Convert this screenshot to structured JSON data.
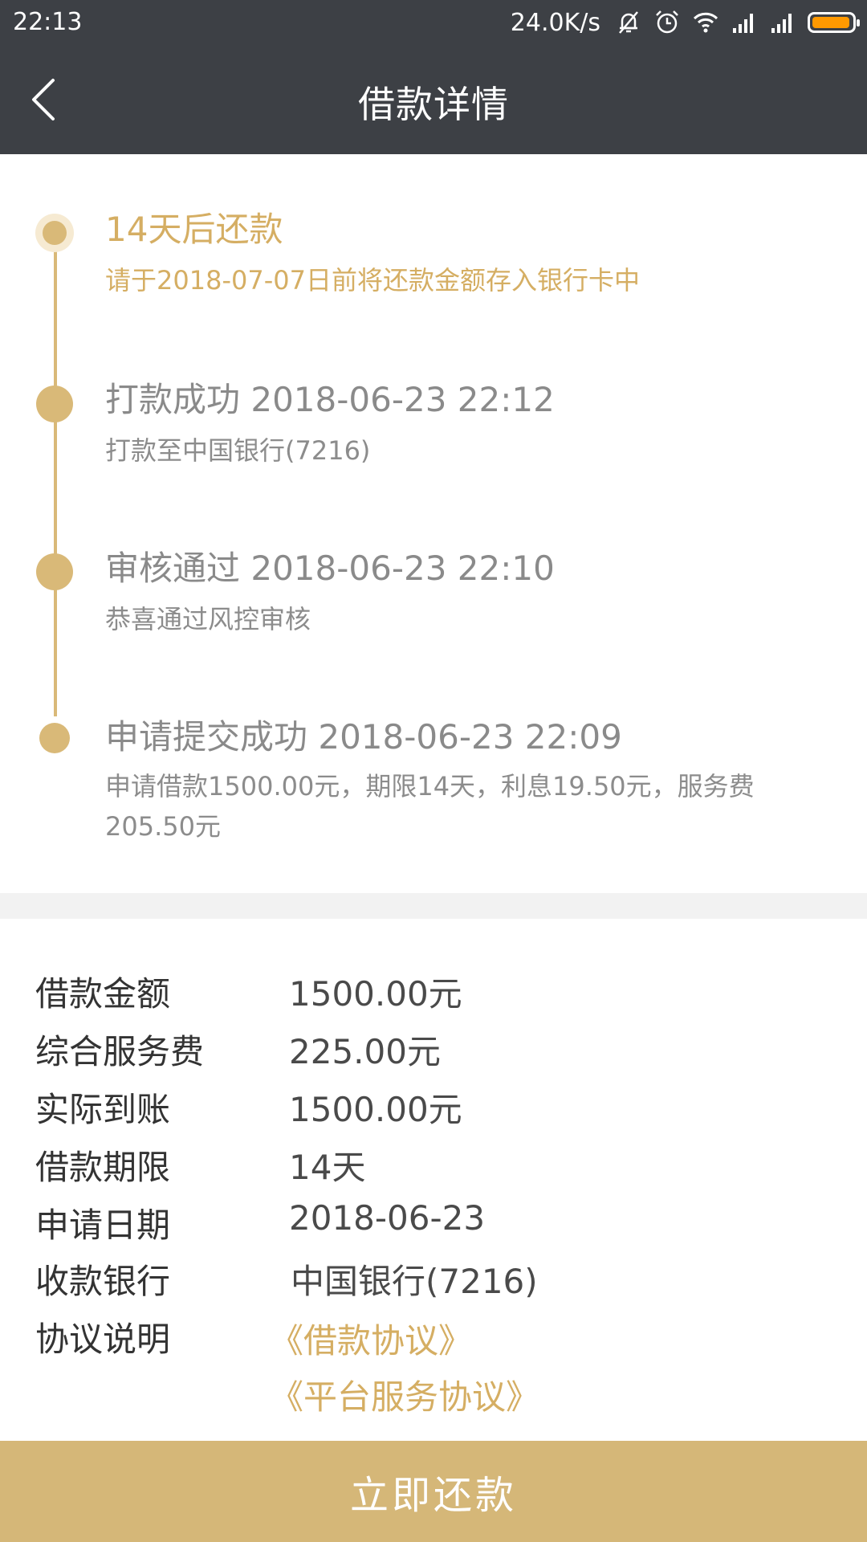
{
  "status_bar": {
    "time": "22:13",
    "network_speed": "24.0K/s",
    "icons": [
      "mute-bell-icon",
      "alarm-icon",
      "wifi-icon",
      "signal-icon",
      "signal-icon",
      "battery-icon"
    ],
    "battery_color": "#ff9900"
  },
  "header": {
    "title": "借款详情",
    "back_icon": "chevron-left-icon"
  },
  "timeline": [
    {
      "title": "14天后还款",
      "subtitle": "请于2018-07-07日前将还款金额存入银行卡中",
      "state": "current"
    },
    {
      "title": "打款成功 2018-06-23 22:12",
      "subtitle": "打款至中国银行(7216)",
      "state": "done"
    },
    {
      "title": "审核通过 2018-06-23 22:10",
      "subtitle": "恭喜通过风控审核",
      "state": "done"
    },
    {
      "title": "申请提交成功 2018-06-23 22:09",
      "subtitle": "申请借款1500.00元，期限14天，利息19.50元，服务费205.50元",
      "state": "done"
    }
  ],
  "details": {
    "rows": [
      {
        "label": "借款金额",
        "value": "1500.00元"
      },
      {
        "label": "综合服务费",
        "value": "225.00元"
      },
      {
        "label": "实际到账",
        "value": "1500.00元"
      },
      {
        "label": "借款期限",
        "value": "14天"
      },
      {
        "label": "申请日期",
        "value": "2018-06-23"
      },
      {
        "label": "收款银行",
        "value": "中国银行(7216)"
      }
    ],
    "agreement_label": "协议说明",
    "agreements": [
      "《借款协议》",
      "《平台服务协议》"
    ]
  },
  "pay_button": "立即还款",
  "colors": {
    "header_bg": "#3d4045",
    "accent_gold": "#d5ae63",
    "button_bg": "#d5b778"
  }
}
